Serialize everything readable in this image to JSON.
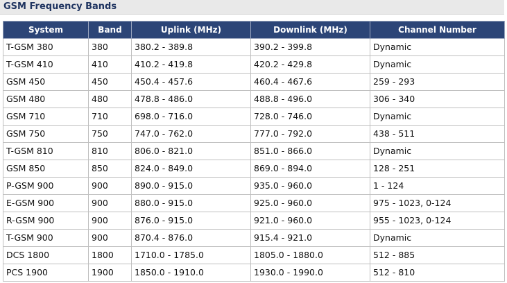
{
  "page": {
    "title": "GSM Frequency Bands"
  },
  "table": {
    "headers": [
      "System",
      "Band",
      "Uplink (MHz)",
      "Downlink (MHz)",
      "Channel Number"
    ],
    "rows": [
      [
        "T-GSM 380",
        "380",
        "380.2 - 389.8",
        "390.2 - 399.8",
        "Dynamic"
      ],
      [
        "T-GSM 410",
        "410",
        "410.2 - 419.8",
        "420.2 - 429.8",
        "Dynamic"
      ],
      [
        "GSM 450",
        "450",
        "450.4 - 457.6",
        "460.4 - 467.6",
        "259 - 293"
      ],
      [
        "GSM 480",
        "480",
        "478.8 - 486.0",
        "488.8 - 496.0",
        "306 - 340"
      ],
      [
        "GSM 710",
        "710",
        "698.0 - 716.0",
        "728.0 - 746.0",
        "Dynamic"
      ],
      [
        "GSM 750",
        "750",
        "747.0 - 762.0",
        "777.0 - 792.0",
        "438 - 511"
      ],
      [
        "T-GSM 810",
        "810",
        "806.0 - 821.0",
        "851.0 - 866.0",
        "Dynamic"
      ],
      [
        "GSM 850",
        "850",
        "824.0 - 849.0",
        "869.0 - 894.0",
        "128 - 251"
      ],
      [
        "P-GSM 900",
        "900",
        "890.0 - 915.0",
        "935.0 - 960.0",
        "1 - 124"
      ],
      [
        "E-GSM 900",
        "900",
        "880.0 - 915.0",
        "925.0 - 960.0",
        "975 - 1023, 0-124"
      ],
      [
        "R-GSM 900",
        "900",
        "876.0 - 915.0",
        "921.0 - 960.0",
        "955 - 1023, 0-124"
      ],
      [
        "T-GSM 900",
        "900",
        "870.4 - 876.0",
        "915.4 - 921.0",
        "Dynamic"
      ],
      [
        "DCS 1800",
        "1800",
        "1710.0 - 1785.0",
        "1805.0 - 1880.0",
        "512 - 885"
      ],
      [
        "PCS 1900",
        "1900",
        "1850.0 - 1910.0",
        "1930.0 - 1990.0",
        "512 - 810"
      ]
    ]
  },
  "colors": {
    "header_bg": "#2c4577",
    "header_text": "#ffffff",
    "title_text": "#1f3460",
    "title_bar_bg": "#e9e9e9"
  }
}
